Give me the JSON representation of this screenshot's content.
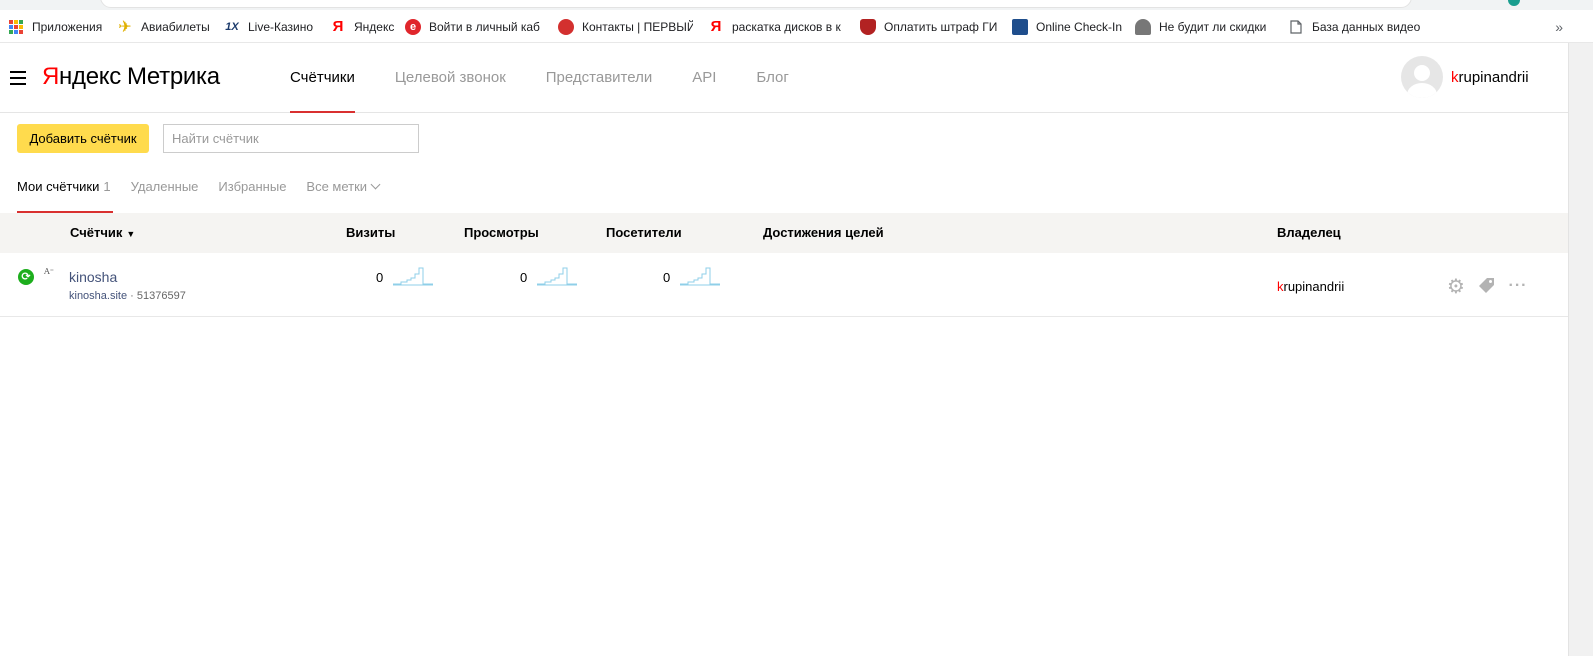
{
  "bookmarks": [
    {
      "label": "Приложения",
      "icon": "apps-grid-icon"
    },
    {
      "label": "Авиабилеты",
      "icon": "airplane-icon"
    },
    {
      "label": "Live-Казино",
      "icon": "1x-icon",
      "glyph": "1X"
    },
    {
      "label": "Яндекс",
      "icon": "yandex-icon",
      "glyph": "Я"
    },
    {
      "label": "Войти в личный каб",
      "icon": "e-icon",
      "glyph": "e"
    },
    {
      "label": "Контакты | ПЕРВЫЙ",
      "icon": "crest-icon"
    },
    {
      "label": "раскатка дисков в к",
      "icon": "yandex-icon",
      "glyph": "Я"
    },
    {
      "label": "Оплатить штраф ГИ",
      "icon": "shield-icon"
    },
    {
      "label": "Online Check-In",
      "icon": "ship-icon"
    },
    {
      "label": "Не будит ли скидки",
      "icon": "figure-icon"
    },
    {
      "label": "База данных видео",
      "icon": "page-icon"
    }
  ],
  "bookmarks_more": "»",
  "header": {
    "logo_ya": "Я",
    "logo_ya_rest": "ндекс",
    "logo_metrika": "Метрика",
    "nav": [
      "Счётчики",
      "Целевой звонок",
      "Представители",
      "API",
      "Блог"
    ],
    "active_nav": 0,
    "user_first": "k",
    "user_rest": "rupinandrii"
  },
  "toolbar": {
    "add_label": "Добавить счётчик",
    "search_placeholder": "Найти счётчик"
  },
  "tabs": {
    "my": "Мои счётчики",
    "my_count": "1",
    "deleted": "Удаленные",
    "favorites": "Избранные",
    "all_tags": "Все метки"
  },
  "table": {
    "headers": {
      "counter": "Счётчик",
      "sort_arrow": "▼",
      "visits": "Визиты",
      "views": "Просмотры",
      "visitors": "Посетители",
      "goals": "Достижения целей",
      "owner": "Владелец"
    },
    "rows": [
      {
        "status_icon": "sync-icon",
        "name": "kinosha",
        "site": "kinosha.site",
        "separator": " · ",
        "id": "51376597",
        "visits": "0",
        "views": "0",
        "visitors": "0",
        "owner_first": "k",
        "owner_rest": "rupinandrii"
      }
    ]
  },
  "colors": {
    "accent_red": "#d93030",
    "button_yellow": "#ffdb4d",
    "status_green": "#1dae1d",
    "spark_blue": "#8fcfe8",
    "link": "#44537a"
  }
}
